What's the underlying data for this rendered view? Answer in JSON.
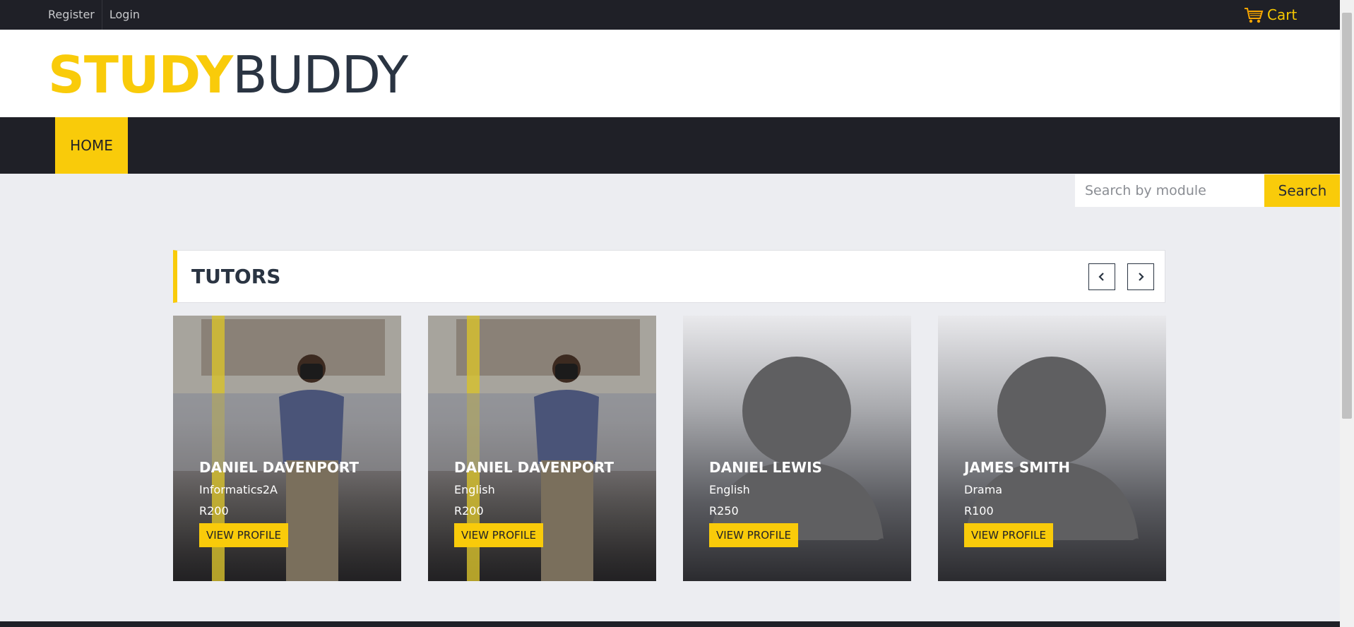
{
  "topbar": {
    "register_label": "Register",
    "login_label": "Login",
    "cart_label": "Cart"
  },
  "logo": {
    "part1": "STUDY",
    "part2": "BUDDY"
  },
  "nav": {
    "home_label": "HOME"
  },
  "search": {
    "placeholder": "Search by module",
    "button_label": "Search"
  },
  "tutors": {
    "title": "TUTORS",
    "cards": [
      {
        "name": "DANIEL DAVENPORT",
        "subject": "Informatics2A",
        "price": "R200",
        "button": "VIEW PROFILE",
        "image": "photo"
      },
      {
        "name": "DANIEL DAVENPORT",
        "subject": "English",
        "price": "R200",
        "button": "VIEW PROFILE",
        "image": "photo"
      },
      {
        "name": "DANIEL LEWIS",
        "subject": "English",
        "price": "R250",
        "button": "VIEW PROFILE",
        "image": "avatar-placeholder"
      },
      {
        "name": "JAMES SMITH",
        "subject": "Drama",
        "price": "R100",
        "button": "VIEW PROFILE",
        "image": "avatar-placeholder"
      }
    ]
  },
  "colors": {
    "accent": "#f9cb0a",
    "dark": "#1f2027",
    "text_dark": "#2a3442",
    "page_bg": "#ecedf1"
  }
}
